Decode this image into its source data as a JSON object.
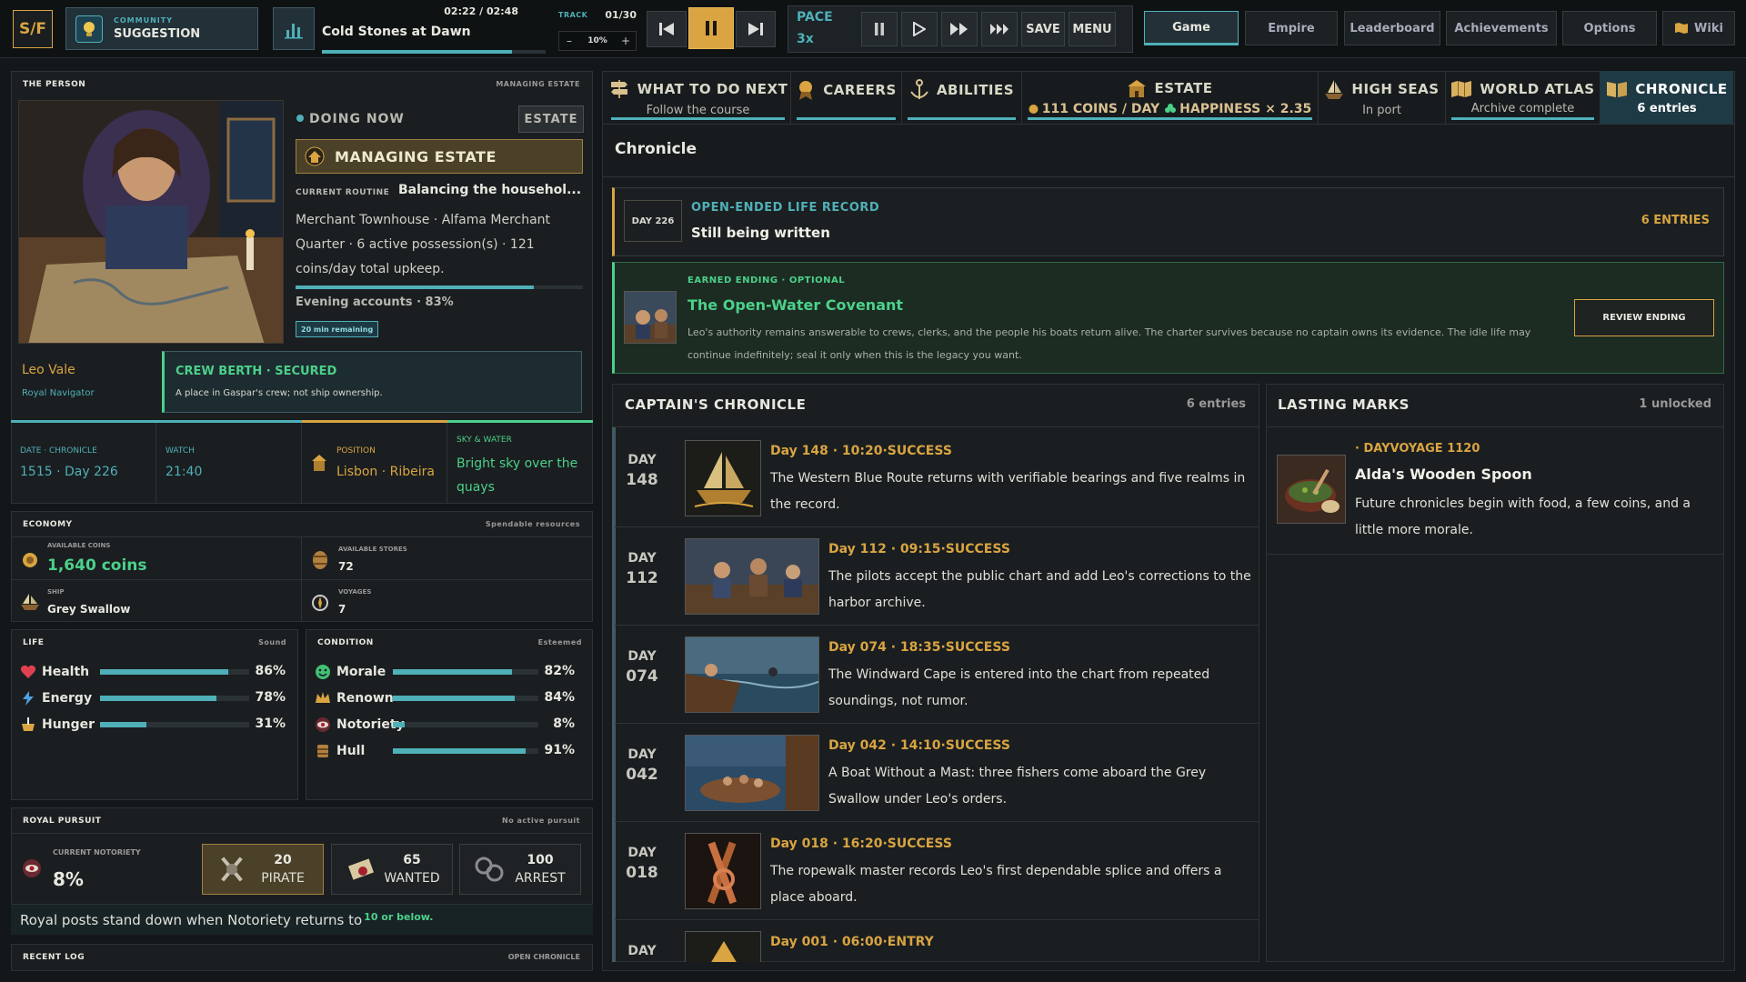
{
  "topbar": {
    "logo": "S/F",
    "community_label": "COMMUNITY",
    "community_value": "SUGGESTION",
    "track_title": "Cold Stones at Dawn",
    "track_time": "02:22 / 02:48",
    "track_label": "TRACK",
    "track_count": "01/30",
    "volume": "10%",
    "vol_minus": "–",
    "vol_plus": "+",
    "pace_label": "PACE",
    "pace_value": "3x",
    "save": "SAVE",
    "menu": "MENU",
    "nav": [
      "Game",
      "Empire",
      "Leaderboard",
      "Achievements",
      "Options",
      "Wiki"
    ],
    "progress": 0.85
  },
  "person": {
    "panel_title": "THE PERSON",
    "panel_sub": "MANAGING ESTATE",
    "doing_now": "DOING NOW",
    "estate_btn": "ESTATE",
    "activity": "MANAGING ESTATE",
    "routine_label": "CURRENT ROUTINE",
    "routine_value": "Balancing the househol...",
    "desc": "Merchant Townhouse · Alfama Merchant Quarter · 6 active possession(s) · 121 coins/day total upkeep.",
    "evening": "Evening accounts · 83%",
    "evening_progress": 0.83,
    "remaining": "20 min remaining",
    "name": "Leo Vale",
    "title": "Royal Navigator",
    "berth_title": "CREW BERTH · SECURED",
    "berth_desc": "A place in Gaspar's crew; not ship ownership."
  },
  "info": {
    "date_label": "DATE · CHRONICLE",
    "date_value": "1515 · Day 226",
    "watch_label": "WATCH",
    "watch_value": "21:40",
    "position_label": "POSITION",
    "position_value": "Lisbon · Ribeira",
    "sky_label": "SKY & WATER",
    "sky_value": "Bright sky over the quays"
  },
  "economy": {
    "title": "ECONOMY",
    "sub": "Spendable resources",
    "coins_label": "AVAILABLE COINS",
    "coins_value": "1,640 coins",
    "stores_label": "AVAILABLE STORES",
    "stores_value": "72",
    "ship_label": "SHIP",
    "ship_value": "Grey Swallow",
    "voyages_label": "VOYAGES",
    "voyages_value": "7"
  },
  "life": {
    "title": "LIFE",
    "sub": "Sound",
    "stats": [
      {
        "name": "Health",
        "value": 86,
        "text": "86%"
      },
      {
        "name": "Energy",
        "value": 78,
        "text": "78%"
      },
      {
        "name": "Hunger",
        "value": 31,
        "text": "31%"
      }
    ]
  },
  "condition": {
    "title": "CONDITION",
    "sub": "Esteemed",
    "stats": [
      {
        "name": "Morale",
        "value": 82,
        "text": "82%"
      },
      {
        "name": "Renown",
        "value": 84,
        "text": "84%"
      },
      {
        "name": "Notoriety",
        "value": 8,
        "text": "8%"
      },
      {
        "name": "Hull",
        "value": 91,
        "text": "91%"
      }
    ]
  },
  "royal": {
    "title": "ROYAL PURSUIT",
    "sub": "No active pursuit",
    "notoriety_label": "CURRENT NOTORIETY",
    "notoriety_value": "8%",
    "tiers": [
      {
        "num": "20",
        "name": "PIRATE"
      },
      {
        "num": "65",
        "name": "WANTED"
      },
      {
        "num": "100",
        "name": "ARREST"
      }
    ],
    "note": "Royal posts stand down when Notoriety returns to",
    "note_hl": "10 or below."
  },
  "recent": {
    "title": "RECENT LOG",
    "sub": "OPEN CHRONICLE"
  },
  "tabs": [
    {
      "title": "WHAT TO DO NEXT",
      "sub": "Follow the course"
    },
    {
      "title": "CAREERS",
      "sub": ""
    },
    {
      "title": "ABILITIES",
      "sub": ""
    },
    {
      "title": "ESTATE",
      "sub_coins": "111 COINS / DAY",
      "sub_happy": "HAPPINESS × 2.35"
    },
    {
      "title": "HIGH SEAS",
      "sub": "In port"
    },
    {
      "title": "WORLD ATLAS",
      "sub": "Archive complete"
    },
    {
      "title": "CHRONICLE",
      "sub": "6 entries"
    }
  ],
  "chronicle": {
    "heading": "Chronicle",
    "life_day": "DAY 226",
    "life_label": "OPEN-ENDED LIFE RECORD",
    "life_value": "Still being written",
    "life_count": "6 ENTRIES",
    "ending_label": "EARNED ENDING · OPTIONAL",
    "ending_title": "The Open-Water Covenant",
    "ending_desc": "Leo's authority remains answerable to crews, clerks, and the people his boats return alive. The charter survives because no captain owns its evidence. The idle life may continue indefinitely; seal it only when this is the legacy you want.",
    "review_btn": "REVIEW ENDING",
    "captain_title": "CAPTAIN'S CHRONICLE",
    "captain_count": "6 entries",
    "entries": [
      {
        "d1": "DAY",
        "d2": "148",
        "head": "Day 148 · 10:20·SUCCESS",
        "body": "The Western Blue Route returns with verifiable bearings and five realms in the record."
      },
      {
        "d1": "DAY",
        "d2": "112",
        "head": "Day 112 · 09:15·SUCCESS",
        "body": "The pilots accept the public chart and add Leo's corrections to the harbor archive."
      },
      {
        "d1": "DAY",
        "d2": "074",
        "head": "Day 074 · 18:35·SUCCESS",
        "body": "The Windward Cape is entered into the chart from repeated soundings, not rumor."
      },
      {
        "d1": "DAY",
        "d2": "042",
        "head": "Day 042 · 14:10·SUCCESS",
        "body": "A Boat Without a Mast: three fishers come aboard the Grey Swallow under Leo's orders."
      },
      {
        "d1": "DAY",
        "d2": "018",
        "head": "Day 018 · 16:20·SUCCESS",
        "body": "The ropewalk master records Leo's first dependable splice and offers a place aboard."
      },
      {
        "d1": "DAY",
        "d2": "",
        "head": "Day 001 · 06:00·ENTRY",
        "body": ""
      }
    ],
    "marks_title": "LASTING MARKS",
    "marks_count": "1 unlocked",
    "mark_label": "· DAYVOYAGE 1120",
    "mark_title": "Alda's Wooden Spoon",
    "mark_desc": "Future chronicles begin with food, a few coins, and a little more morale."
  }
}
